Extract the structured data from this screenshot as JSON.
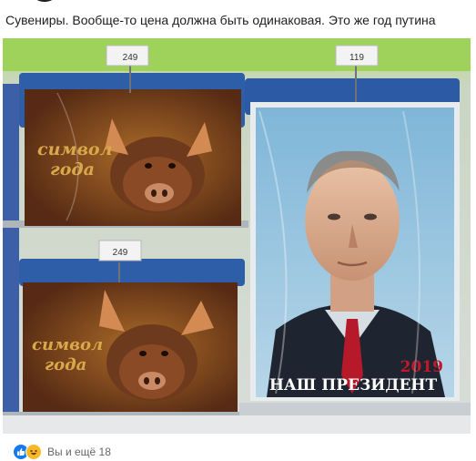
{
  "post": {
    "caption": "Сувениры. Вообще-то цена должна быть одинаковая. Это же год путина",
    "photo": {
      "calendar_pig_top": {
        "title_line1": "символ",
        "title_line2": "года",
        "price": "249"
      },
      "calendar_pig_bottom": {
        "title_line1": "символ",
        "title_line2": "года",
        "price": "249"
      },
      "calendar_putin": {
        "year": "2019",
        "title": "НАШ ПРЕЗИДЕНТ",
        "price": "119"
      }
    },
    "reactions": {
      "icons": [
        "like-icon",
        "haha-icon"
      ],
      "summary": "Вы и ещё 18"
    }
  }
}
